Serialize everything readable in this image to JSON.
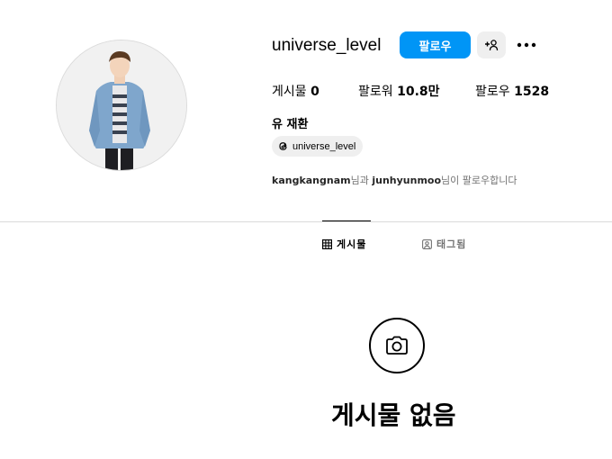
{
  "profile": {
    "username": "universe_level",
    "follow_label": "팔로우",
    "suggest_icon": "person-add-icon",
    "more_icon": "more-horizontal-icon",
    "stats": {
      "posts_label": "게시물",
      "posts_value": "0",
      "followers_label": "팔로워",
      "followers_value": "10.8만",
      "following_label": "팔로우",
      "following_value": "1528"
    },
    "full_name": "유 재환",
    "threads_handle": "universe_level",
    "followed_by": {
      "user1": "kangkangnam",
      "connector": "님과",
      "user2": "junhyunmoo",
      "suffix": "님이 팔로우합니다"
    }
  },
  "tabs": [
    {
      "label": "게시물",
      "icon": "grid-icon",
      "active": true
    },
    {
      "label": "태그됨",
      "icon": "tagged-icon",
      "active": false
    }
  ],
  "empty_state": {
    "icon": "camera-icon",
    "title": "게시물 없음"
  },
  "colors": {
    "accent": "#0095f6",
    "muted_text": "#737373",
    "chip_bg": "#efefef"
  }
}
